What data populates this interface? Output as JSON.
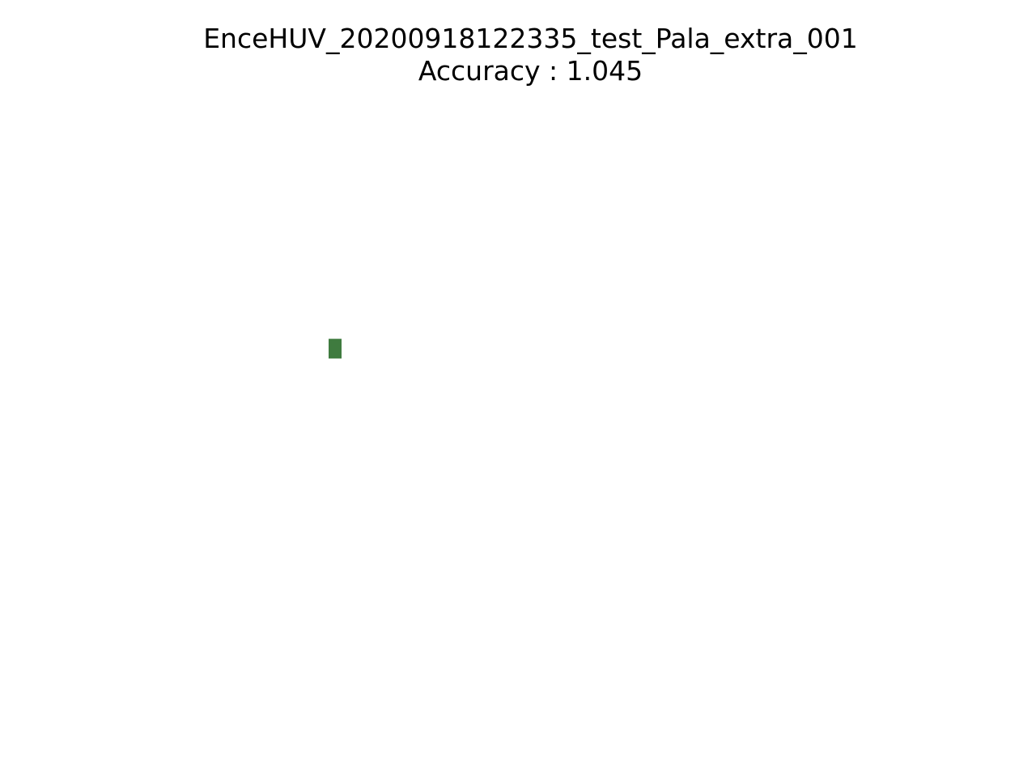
{
  "chart_data": {
    "type": "heatmap",
    "title": "EnceHUV_20200918122335_test_Pala_extra_001",
    "subtitle": "Accuracy : 1.045",
    "axes_visible": false,
    "grid": false,
    "xlim": [
      0,
      38
    ],
    "ylim": [
      0,
      30
    ],
    "cells": [
      {
        "x": 10,
        "y": 12,
        "value": 1,
        "color": "#3f7b3f"
      }
    ]
  }
}
